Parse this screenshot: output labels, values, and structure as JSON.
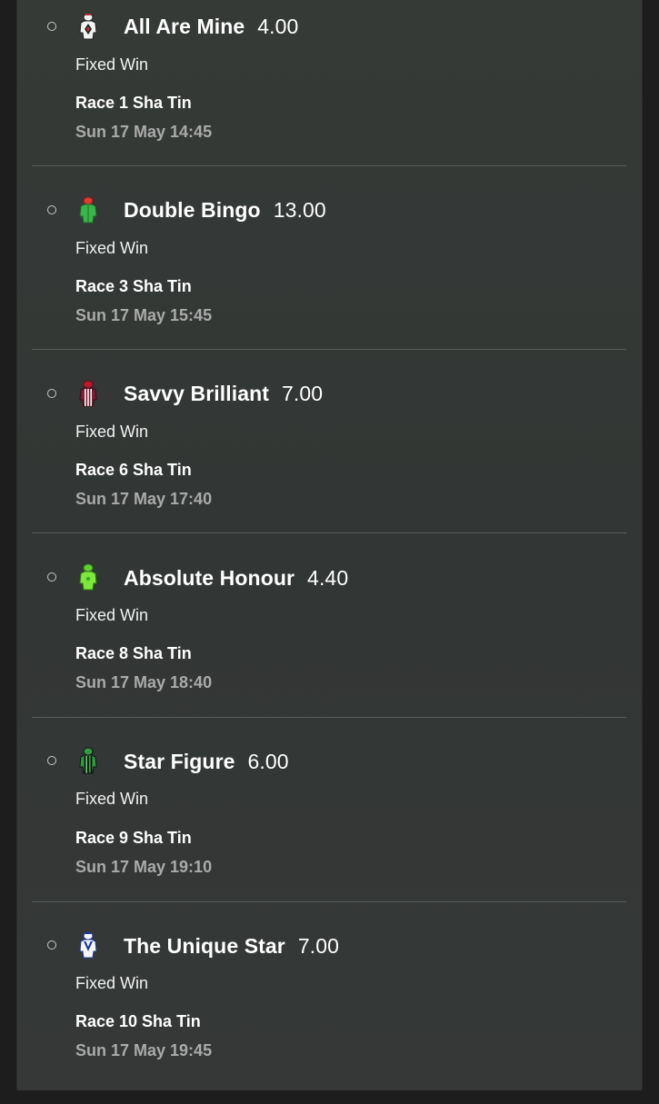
{
  "bet_type_label": "Fixed Win",
  "selections": [
    {
      "horse": "All Are Mine",
      "odds": "4.00",
      "race": "Race 1 Sha Tin",
      "datetime": "Sun 17 May 14:45",
      "silk": "jockey-silk-white-black-diamond-icon",
      "silk_colors": [
        "#f2f2f2",
        "#222222",
        "#c0303a"
      ]
    },
    {
      "horse": "Double Bingo",
      "odds": "13.00",
      "race": "Race 3 Sha Tin",
      "datetime": "Sun 17 May 15:45",
      "silk": "jockey-silk-green-red-cap-icon",
      "silk_colors": [
        "#3bb54a",
        "#e23a2e",
        "#1d6b2a"
      ]
    },
    {
      "horse": "Savvy Brilliant",
      "odds": "7.00",
      "race": "Race 6 Sha Tin",
      "datetime": "Sun 17 May 17:40",
      "silk": "jockey-silk-maroon-white-stripes-icon",
      "silk_colors": [
        "#7a1f35",
        "#f5f5f5",
        "#c0182b"
      ]
    },
    {
      "horse": "Absolute Honour",
      "odds": "4.40",
      "race": "Race 8 Sha Tin",
      "datetime": "Sun 17 May 18:40",
      "silk": "jockey-silk-lime-green-icon",
      "silk_colors": [
        "#7ee83c",
        "#3aa82a",
        "#5fd22e"
      ]
    },
    {
      "horse": "Star Figure",
      "odds": "6.00",
      "race": "Race 9 Sha Tin",
      "datetime": "Sun 17 May 19:10",
      "silk": "jockey-silk-green-black-stripes-icon",
      "silk_colors": [
        "#2e9e3e",
        "#111111",
        "#8fd88f"
      ]
    },
    {
      "horse": "The Unique Star",
      "odds": "7.00",
      "race": "Race 10 Sha Tin",
      "datetime": "Sun 17 May 19:45",
      "silk": "jockey-silk-white-blue-v-icon",
      "silk_colors": [
        "#f5f5f5",
        "#1e3a9e",
        "#1e3a9e"
      ]
    }
  ]
}
